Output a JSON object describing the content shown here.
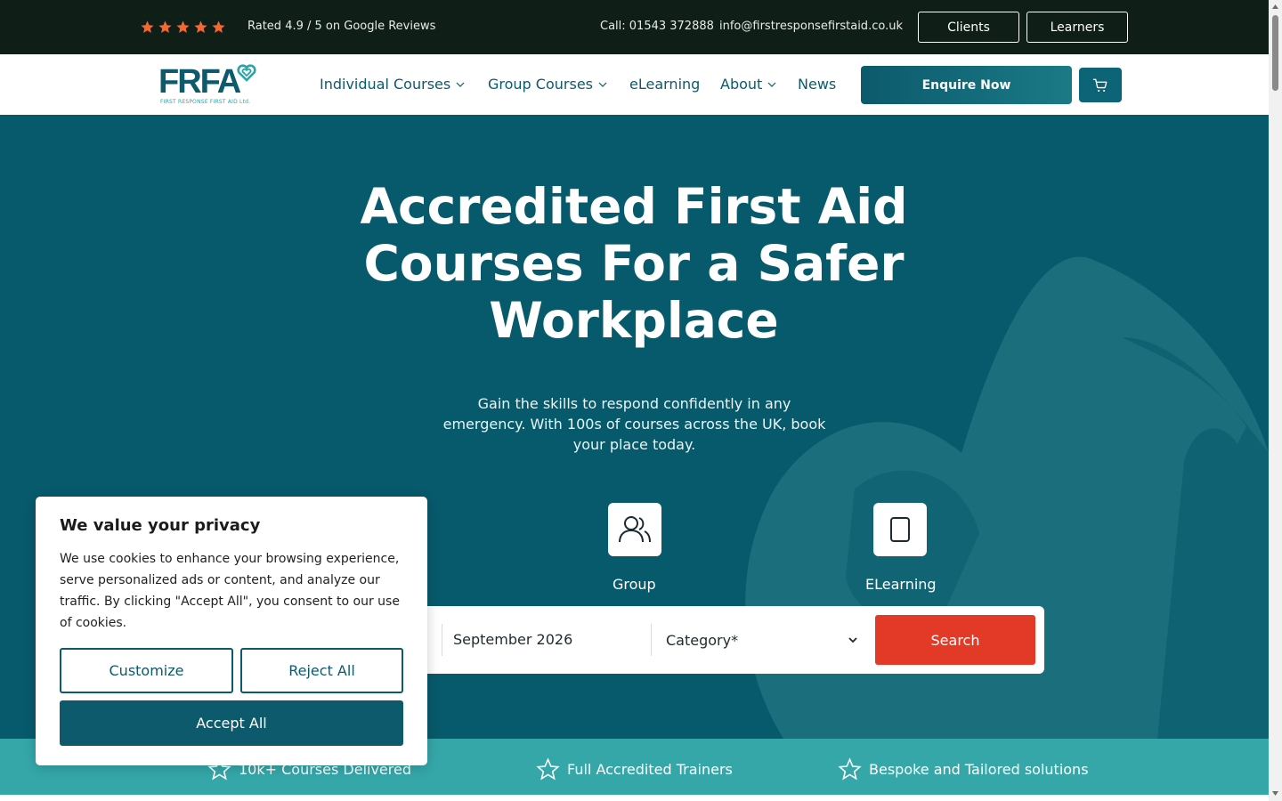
{
  "topbar": {
    "rating_text": "Rated 4.9 / 5 on Google Reviews",
    "stars": 5,
    "star_color": "#f06a35",
    "call_text": "Call: 01543 372888",
    "email_text": "info@firstresponsefirstaid.co.uk",
    "clients_label": "Clients",
    "learners_label": "Learners"
  },
  "nav": {
    "logo_text": "FRFA",
    "logo_subtitle": "FIRST RESPONSE FIRST AID Ltd.",
    "items": [
      {
        "label": "Individual Courses",
        "has_dropdown": true
      },
      {
        "label": "Group Courses",
        "has_dropdown": true
      },
      {
        "label": "eLearning",
        "has_dropdown": false
      },
      {
        "label": "About",
        "has_dropdown": true
      },
      {
        "label": "News",
        "has_dropdown": false
      }
    ],
    "enquire_label": "Enquire Now",
    "cart_icon": "cart-icon"
  },
  "hero": {
    "title_lines": [
      "Accredited First Aid",
      "Courses For a Safer",
      "Workplace"
    ],
    "subtitle": "Gain the skills to respond confidently in any emergency. With 100s of courses across the UK, book your place today.",
    "types": [
      {
        "label": "Group",
        "icon": "users-icon"
      },
      {
        "label": "ELearning",
        "icon": "tablet-icon"
      }
    ],
    "search": {
      "month_value": "September 2026",
      "category_value": "Category*",
      "search_label": "Search"
    }
  },
  "features": [
    {
      "label": "10k+ Courses Delivered",
      "icon": "star-outline-icon"
    },
    {
      "label": "Full Accredited Trainers",
      "icon": "star-outline-icon"
    },
    {
      "label": "Bespoke and Tailored solutions",
      "icon": "star-outline-icon"
    }
  ],
  "cookie": {
    "title": "We value your privacy",
    "body": "We use cookies to enhance your browsing experience, serve personalized ads or content, and analyze our traffic. By clicking \"Accept All\", you consent to our use of cookies.",
    "customize_label": "Customize",
    "reject_label": "Reject All",
    "accept_label": "Accept All"
  },
  "colors": {
    "brand_teal": "#0c5a6c",
    "hero_bg": "#075a6c",
    "strip_bg": "#35a7a9",
    "search_button": "#e33a28",
    "topbar_bg": "#0f1f17"
  }
}
